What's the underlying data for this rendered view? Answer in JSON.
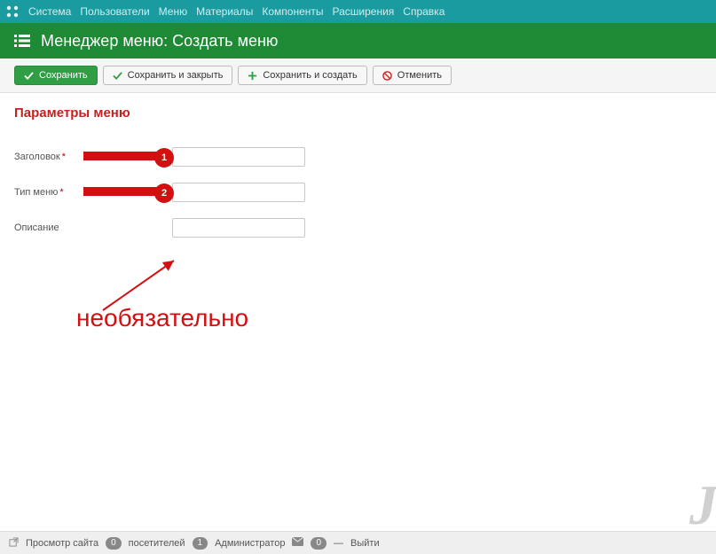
{
  "topnav": {
    "items": [
      "Система",
      "Пользователи",
      "Меню",
      "Материалы",
      "Компоненты",
      "Расширения",
      "Справка"
    ]
  },
  "titlebar": {
    "title": "Менеджер меню: Создать меню"
  },
  "toolbar": {
    "save": "Сохранить",
    "save_close": "Сохранить и закрыть",
    "save_new": "Сохранить и создать",
    "cancel": "Отменить"
  },
  "section": {
    "heading": "Параметры меню"
  },
  "form": {
    "title_label": "Заголовок",
    "title_value": "",
    "type_label": "Тип меню",
    "type_value": "",
    "desc_label": "Описание",
    "desc_value": ""
  },
  "callouts": {
    "badge1": "1",
    "badge2": "2",
    "optional_text": "необязательно"
  },
  "status": {
    "preview": "Просмотр сайта",
    "visitors_count": "0",
    "visitors_label": "посетителей",
    "admins_count": "1",
    "admins_label": "Администратор",
    "msg_count": "0",
    "logout": "Выйти"
  },
  "watermark": "J"
}
